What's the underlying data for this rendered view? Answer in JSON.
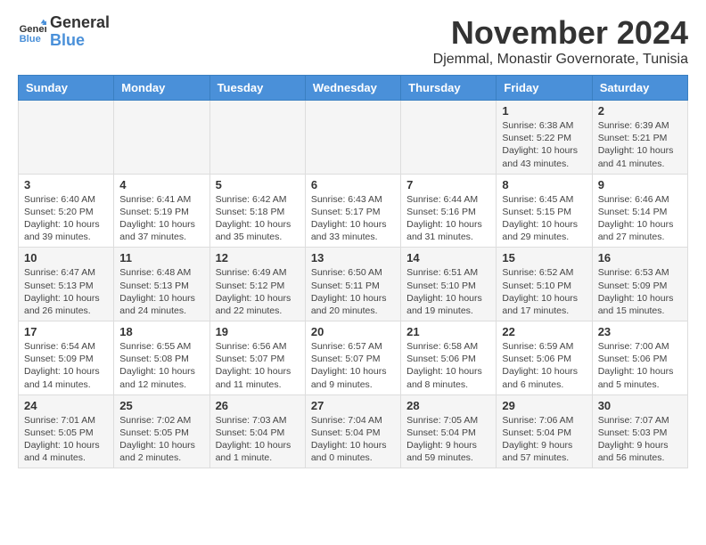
{
  "header": {
    "logo_line1": "General",
    "logo_line2": "Blue",
    "month_title": "November 2024",
    "location": "Djemmal, Monastir Governorate, Tunisia"
  },
  "weekdays": [
    "Sunday",
    "Monday",
    "Tuesday",
    "Wednesday",
    "Thursday",
    "Friday",
    "Saturday"
  ],
  "weeks": [
    [
      {
        "day": "",
        "info": ""
      },
      {
        "day": "",
        "info": ""
      },
      {
        "day": "",
        "info": ""
      },
      {
        "day": "",
        "info": ""
      },
      {
        "day": "",
        "info": ""
      },
      {
        "day": "1",
        "info": "Sunrise: 6:38 AM\nSunset: 5:22 PM\nDaylight: 10 hours and 43 minutes."
      },
      {
        "day": "2",
        "info": "Sunrise: 6:39 AM\nSunset: 5:21 PM\nDaylight: 10 hours and 41 minutes."
      }
    ],
    [
      {
        "day": "3",
        "info": "Sunrise: 6:40 AM\nSunset: 5:20 PM\nDaylight: 10 hours and 39 minutes."
      },
      {
        "day": "4",
        "info": "Sunrise: 6:41 AM\nSunset: 5:19 PM\nDaylight: 10 hours and 37 minutes."
      },
      {
        "day": "5",
        "info": "Sunrise: 6:42 AM\nSunset: 5:18 PM\nDaylight: 10 hours and 35 minutes."
      },
      {
        "day": "6",
        "info": "Sunrise: 6:43 AM\nSunset: 5:17 PM\nDaylight: 10 hours and 33 minutes."
      },
      {
        "day": "7",
        "info": "Sunrise: 6:44 AM\nSunset: 5:16 PM\nDaylight: 10 hours and 31 minutes."
      },
      {
        "day": "8",
        "info": "Sunrise: 6:45 AM\nSunset: 5:15 PM\nDaylight: 10 hours and 29 minutes."
      },
      {
        "day": "9",
        "info": "Sunrise: 6:46 AM\nSunset: 5:14 PM\nDaylight: 10 hours and 27 minutes."
      }
    ],
    [
      {
        "day": "10",
        "info": "Sunrise: 6:47 AM\nSunset: 5:13 PM\nDaylight: 10 hours and 26 minutes."
      },
      {
        "day": "11",
        "info": "Sunrise: 6:48 AM\nSunset: 5:13 PM\nDaylight: 10 hours and 24 minutes."
      },
      {
        "day": "12",
        "info": "Sunrise: 6:49 AM\nSunset: 5:12 PM\nDaylight: 10 hours and 22 minutes."
      },
      {
        "day": "13",
        "info": "Sunrise: 6:50 AM\nSunset: 5:11 PM\nDaylight: 10 hours and 20 minutes."
      },
      {
        "day": "14",
        "info": "Sunrise: 6:51 AM\nSunset: 5:10 PM\nDaylight: 10 hours and 19 minutes."
      },
      {
        "day": "15",
        "info": "Sunrise: 6:52 AM\nSunset: 5:10 PM\nDaylight: 10 hours and 17 minutes."
      },
      {
        "day": "16",
        "info": "Sunrise: 6:53 AM\nSunset: 5:09 PM\nDaylight: 10 hours and 15 minutes."
      }
    ],
    [
      {
        "day": "17",
        "info": "Sunrise: 6:54 AM\nSunset: 5:09 PM\nDaylight: 10 hours and 14 minutes."
      },
      {
        "day": "18",
        "info": "Sunrise: 6:55 AM\nSunset: 5:08 PM\nDaylight: 10 hours and 12 minutes."
      },
      {
        "day": "19",
        "info": "Sunrise: 6:56 AM\nSunset: 5:07 PM\nDaylight: 10 hours and 11 minutes."
      },
      {
        "day": "20",
        "info": "Sunrise: 6:57 AM\nSunset: 5:07 PM\nDaylight: 10 hours and 9 minutes."
      },
      {
        "day": "21",
        "info": "Sunrise: 6:58 AM\nSunset: 5:06 PM\nDaylight: 10 hours and 8 minutes."
      },
      {
        "day": "22",
        "info": "Sunrise: 6:59 AM\nSunset: 5:06 PM\nDaylight: 10 hours and 6 minutes."
      },
      {
        "day": "23",
        "info": "Sunrise: 7:00 AM\nSunset: 5:06 PM\nDaylight: 10 hours and 5 minutes."
      }
    ],
    [
      {
        "day": "24",
        "info": "Sunrise: 7:01 AM\nSunset: 5:05 PM\nDaylight: 10 hours and 4 minutes."
      },
      {
        "day": "25",
        "info": "Sunrise: 7:02 AM\nSunset: 5:05 PM\nDaylight: 10 hours and 2 minutes."
      },
      {
        "day": "26",
        "info": "Sunrise: 7:03 AM\nSunset: 5:04 PM\nDaylight: 10 hours and 1 minute."
      },
      {
        "day": "27",
        "info": "Sunrise: 7:04 AM\nSunset: 5:04 PM\nDaylight: 10 hours and 0 minutes."
      },
      {
        "day": "28",
        "info": "Sunrise: 7:05 AM\nSunset: 5:04 PM\nDaylight: 9 hours and 59 minutes."
      },
      {
        "day": "29",
        "info": "Sunrise: 7:06 AM\nSunset: 5:04 PM\nDaylight: 9 hours and 57 minutes."
      },
      {
        "day": "30",
        "info": "Sunrise: 7:07 AM\nSunset: 5:03 PM\nDaylight: 9 hours and 56 minutes."
      }
    ]
  ]
}
